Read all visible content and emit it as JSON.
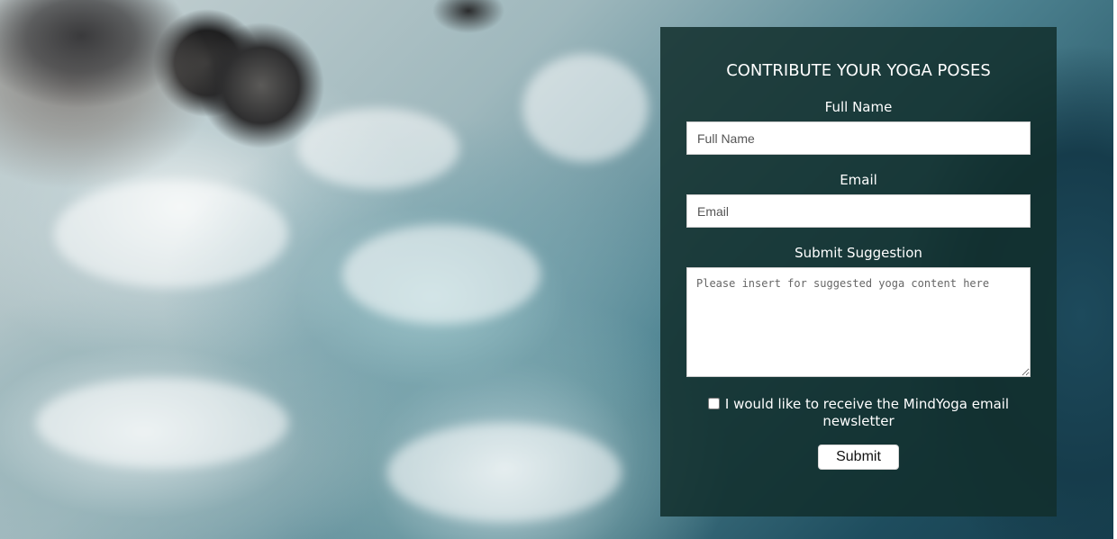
{
  "form": {
    "title": "CONTRIBUTE YOUR YOGA POSES",
    "full_name": {
      "label": "Full Name",
      "placeholder": "Full Name",
      "value": ""
    },
    "email": {
      "label": "Email",
      "placeholder": "Email",
      "value": ""
    },
    "suggestion": {
      "label": "Submit Suggestion",
      "placeholder": "Please insert for suggested yoga content here",
      "value": ""
    },
    "newsletter": {
      "label": "I would like to receive the MindYoga email newsletter",
      "checked": false
    },
    "submit_label": "Submit"
  },
  "colors": {
    "panel_background": "#122e2c",
    "text": "#ffffff",
    "input_background": "#ffffff"
  }
}
